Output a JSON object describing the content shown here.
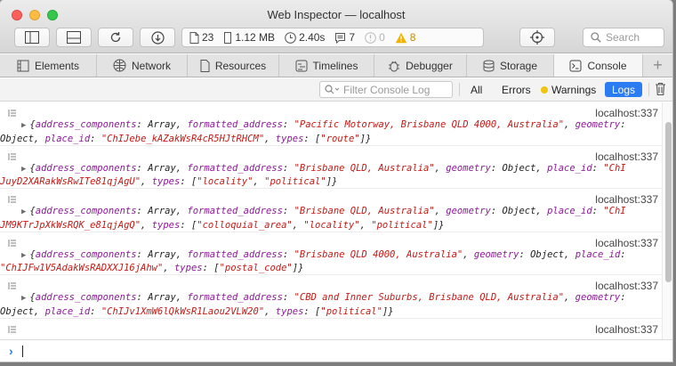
{
  "window": {
    "title": "Web Inspector — localhost"
  },
  "toolbar": {
    "dashboard": {
      "resources": "23",
      "size": "1.12 MB",
      "time": "2.40s",
      "logs": "7",
      "errors": "0",
      "warnings": "8"
    },
    "search_placeholder": "Search"
  },
  "tabs": [
    {
      "label": "Elements",
      "icon": "elements-icon"
    },
    {
      "label": "Network",
      "icon": "network-icon"
    },
    {
      "label": "Resources",
      "icon": "resources-icon"
    },
    {
      "label": "Timelines",
      "icon": "timelines-icon"
    },
    {
      "label": "Debugger",
      "icon": "debugger-icon"
    },
    {
      "label": "Storage",
      "icon": "storage-icon"
    },
    {
      "label": "Console",
      "icon": "console-icon",
      "active": true
    }
  ],
  "console_filter": {
    "placeholder": "Filter Console Log",
    "all": "All",
    "errors": "Errors",
    "warnings": "Warnings",
    "logs": "Logs"
  },
  "messages": [
    {
      "location": "localhost:337",
      "line1": [
        [
          "p",
          "{"
        ],
        [
          "k",
          "address_components"
        ],
        [
          "p",
          ": Array, "
        ],
        [
          "k",
          "formatted_address"
        ],
        [
          "p",
          ": "
        ],
        [
          "s",
          "\"Pacific Motorway, Brisbane QLD 4000, Australia\""
        ],
        [
          "p",
          ", "
        ],
        [
          "k",
          "geometry"
        ],
        [
          "p",
          ":"
        ]
      ],
      "line2": [
        [
          "p",
          "Object, "
        ],
        [
          "k",
          "place_id"
        ],
        [
          "p",
          ": "
        ],
        [
          "s",
          "\"ChIJebe_kAZakWsR4cR5HJtRHCM\""
        ],
        [
          "p",
          ", "
        ],
        [
          "k",
          "types"
        ],
        [
          "p",
          ": ["
        ],
        [
          "s",
          "\"route\""
        ],
        [
          "p",
          "]}"
        ]
      ]
    },
    {
      "location": "localhost:337",
      "line1": [
        [
          "p",
          "{"
        ],
        [
          "k",
          "address_components"
        ],
        [
          "p",
          ": Array, "
        ],
        [
          "k",
          "formatted_address"
        ],
        [
          "p",
          ": "
        ],
        [
          "s",
          "\"Brisbane QLD, Australia\""
        ],
        [
          "p",
          ", "
        ],
        [
          "k",
          "geometry"
        ],
        [
          "p",
          ": Object, "
        ],
        [
          "k",
          "place_id"
        ],
        [
          "p",
          ": "
        ],
        [
          "s",
          "\"ChI"
        ]
      ],
      "line2": [
        [
          "s",
          "JuyD2XARakWsRwITe81qjAgU\""
        ],
        [
          "p",
          ", "
        ],
        [
          "k",
          "types"
        ],
        [
          "p",
          ": ["
        ],
        [
          "s",
          "\"locality\""
        ],
        [
          "p",
          ", "
        ],
        [
          "s",
          "\"political\""
        ],
        [
          "p",
          "]}"
        ]
      ]
    },
    {
      "location": "localhost:337",
      "line1": [
        [
          "p",
          "{"
        ],
        [
          "k",
          "address_components"
        ],
        [
          "p",
          ": Array, "
        ],
        [
          "k",
          "formatted_address"
        ],
        [
          "p",
          ": "
        ],
        [
          "s",
          "\"Brisbane QLD, Australia\""
        ],
        [
          "p",
          ", "
        ],
        [
          "k",
          "geometry"
        ],
        [
          "p",
          ": Object, "
        ],
        [
          "k",
          "place_id"
        ],
        [
          "p",
          ": "
        ],
        [
          "s",
          "\"ChI"
        ]
      ],
      "line2": [
        [
          "s",
          "JM9KTrJpXkWsRQK_e81qjAgQ\""
        ],
        [
          "p",
          ", "
        ],
        [
          "k",
          "types"
        ],
        [
          "p",
          ": ["
        ],
        [
          "s",
          "\"colloquial_area\""
        ],
        [
          "p",
          ", "
        ],
        [
          "s",
          "\"locality\""
        ],
        [
          "p",
          ", "
        ],
        [
          "s",
          "\"political\""
        ],
        [
          "p",
          "]}"
        ]
      ]
    },
    {
      "location": "localhost:337",
      "line1": [
        [
          "p",
          "{"
        ],
        [
          "k",
          "address_components"
        ],
        [
          "p",
          ": Array, "
        ],
        [
          "k",
          "formatted_address"
        ],
        [
          "p",
          ": "
        ],
        [
          "s",
          "\"Brisbane QLD 4000, Australia\""
        ],
        [
          "p",
          ", "
        ],
        [
          "k",
          "geometry"
        ],
        [
          "p",
          ": Object, "
        ],
        [
          "k",
          "place_id"
        ],
        [
          "p",
          ":"
        ]
      ],
      "line2": [
        [
          "s",
          "\"ChIJFw1V5AdakWsRADXXJ16jAhw\""
        ],
        [
          "p",
          ", "
        ],
        [
          "k",
          "types"
        ],
        [
          "p",
          ": ["
        ],
        [
          "s",
          "\"postal_code\""
        ],
        [
          "p",
          "]}"
        ]
      ]
    },
    {
      "location": "localhost:337",
      "line1": [
        [
          "p",
          "{"
        ],
        [
          "k",
          "address_components"
        ],
        [
          "p",
          ": Array, "
        ],
        [
          "k",
          "formatted_address"
        ],
        [
          "p",
          ": "
        ],
        [
          "s",
          "\"CBD and Inner Suburbs, Brisbane QLD, Australia\""
        ],
        [
          "p",
          ", "
        ],
        [
          "k",
          "geometry"
        ],
        [
          "p",
          ":"
        ]
      ],
      "line2": [
        [
          "p",
          "Object, "
        ],
        [
          "k",
          "place_id"
        ],
        [
          "p",
          ": "
        ],
        [
          "s",
          "\"ChIJv1XmW6lQkWsR1Laou2VLW20\""
        ],
        [
          "p",
          ", "
        ],
        [
          "k",
          "types"
        ],
        [
          "p",
          ": ["
        ],
        [
          "s",
          "\"political\""
        ],
        [
          "p",
          "]}"
        ]
      ]
    },
    {
      "location": "localhost:337",
      "line1": [],
      "line2": []
    }
  ]
}
